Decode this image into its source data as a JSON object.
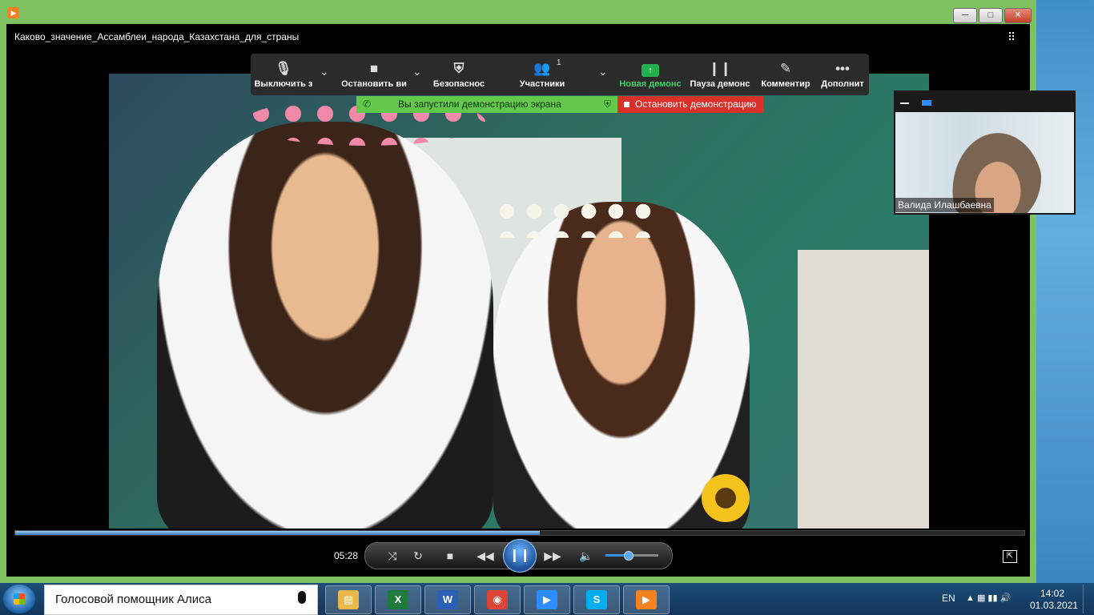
{
  "window": {
    "title": "Каково_значение_Ассамблеи_народа_Казахстана_для_страны",
    "controls": {
      "minimize": "─",
      "maximize": "□",
      "close": "✕"
    }
  },
  "zoom_toolbar": {
    "mute_label": "Выключить з",
    "video_label": "Остановить ви",
    "security_label": "Безопаснос",
    "participants_label": "Участники",
    "participants_count": "1",
    "new_share_label": "Новая демонс",
    "pause_share_label": "Пауза демонс",
    "annotate_label": "Комментир",
    "more_label": "Дополнит"
  },
  "share_banner": {
    "status_text": "Вы запустили демонстрацию экрана",
    "stop_text": "Остановить демонстрацию"
  },
  "participant": {
    "name": "Валида Илашбаевна"
  },
  "player": {
    "elapsed": "05:28",
    "progress": 0.52,
    "volume": 0.42
  },
  "taskbar": {
    "search_text": "Голосовой помощник Алиса",
    "language": "EN",
    "time": "14:02",
    "date": "01.03.2021",
    "apps": [
      {
        "name": "file-explorer-icon",
        "glyph": "▤",
        "color": "#e8b84a"
      },
      {
        "name": "excel-icon",
        "glyph": "X",
        "color": "#1f7a3c"
      },
      {
        "name": "word-icon",
        "glyph": "W",
        "color": "#2b5fb5"
      },
      {
        "name": "chrome-icon",
        "glyph": "◉",
        "color": "#db4437"
      },
      {
        "name": "zoom-icon",
        "glyph": "▶",
        "color": "#2d8cff"
      },
      {
        "name": "skype-icon",
        "glyph": "S",
        "color": "#00aff0"
      },
      {
        "name": "media-player-icon",
        "glyph": "▶",
        "color": "#f58220"
      }
    ]
  }
}
